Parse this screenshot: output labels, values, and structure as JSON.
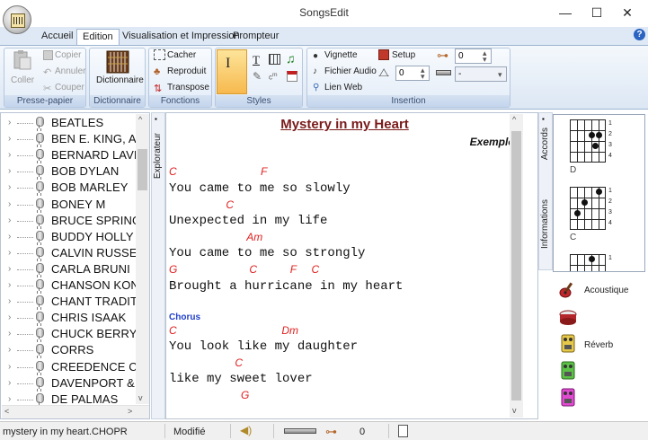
{
  "window": {
    "title": "SongsEdit",
    "controls": {
      "minimize": "—",
      "maximize": "☐",
      "close": "✕"
    }
  },
  "tabs": [
    {
      "label": "Accueil"
    },
    {
      "label": "Edition",
      "active": true
    },
    {
      "label": "Visualisation et Impression"
    },
    {
      "label": "Prompteur"
    }
  ],
  "help_label": "?",
  "ribbon": {
    "presse_papier": {
      "label": "Presse-papier",
      "coller": "Coller",
      "copier": "Copier",
      "annuler": "Annuler",
      "couper": "Couper"
    },
    "dictionnaire": {
      "label": "Dictionnaire",
      "button": "Dictionnaire"
    },
    "fonctions": {
      "label": "Fonctions",
      "cacher": "Cacher",
      "reproduit": "Reproduit",
      "transpose": "Transpose"
    },
    "styles": {
      "label": "Styles"
    },
    "insertion": {
      "label": "Insertion",
      "vignette": "Vignette",
      "fichier_audio": "Fichier Audio",
      "lien_web": "Lien Web",
      "setup": "Setup",
      "tempo_value": "0",
      "capo_value": "0",
      "harmonica_value": "-"
    }
  },
  "tree": {
    "items": [
      "BEATLES",
      "BEN E. KING, AS",
      "BERNARD LAVIL",
      "BOB DYLAN",
      "BOB MARLEY",
      "BONEY M",
      "BRUCE SPRINGS",
      "BUDDY HOLLY",
      "CALVIN RUSSEL",
      "CARLA BRUNI",
      "CHANSON KONC",
      "CHANT TRADIT",
      "CHRIS ISAAK",
      "CHUCK BERRY",
      "CORRS",
      "CREEDENCE CLE",
      "DAVENPORT &",
      "DE PALMAS"
    ]
  },
  "side_tabs": {
    "explorer": "Explorateur",
    "accords": "Accords",
    "informations": "Informations"
  },
  "song": {
    "title": "Mystery in my Heart",
    "subtitle": "Exemple",
    "chorus_label": "Chorus",
    "lines": [
      {
        "chords": "C                            F",
        "lyric": "You came to me so slowly"
      },
      {
        "chords": "                   C",
        "lyric": "Unexpected in my life"
      },
      {
        "chords": "                          Am",
        "lyric": "You came to me so strongly"
      },
      {
        "chords": "G                        C           F     C",
        "lyric": "Brought a hurricane in my heart"
      },
      {
        "chords": "C                                   Dm",
        "lyric": "You look like my daughter"
      },
      {
        "chords": "                      C",
        "lyric": "like my sweet lover"
      },
      {
        "chords": "                        G",
        "lyric": ""
      }
    ]
  },
  "chord_diagrams": [
    {
      "name": "D",
      "frets": [
        "1",
        "2",
        "3",
        "4"
      ]
    },
    {
      "name": "C",
      "frets": [
        "1",
        "2",
        "3",
        "4"
      ]
    },
    {
      "name": "",
      "frets": [
        "1"
      ]
    }
  ],
  "instruments": [
    {
      "label": "Acoustique",
      "icon": "electric-guitar-icon"
    },
    {
      "label": "",
      "icon": "drums-icon"
    },
    {
      "label": "Réverb",
      "icon": "pedal-icon"
    },
    {
      "label": "",
      "icon": "pedal-green-icon"
    },
    {
      "label": "",
      "icon": "pedal-pink-icon"
    }
  ],
  "status": {
    "filename": "mystery in my heart.CHOPR",
    "state": "Modifié",
    "capo_value": "0"
  },
  "colors": {
    "chord": "#e02020",
    "title": "#7a1a1a",
    "chorus": "#1f3ec9",
    "ribbon_bg": "#dce7f4"
  }
}
